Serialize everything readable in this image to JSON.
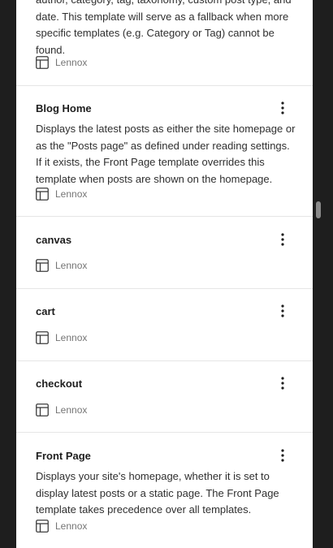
{
  "top_partial": {
    "desc_lines": [
      "author, category, tag, taxonomy, custom post type, and",
      "date. This template will serve as a fallback when more",
      "specific templates (e.g. Category or Tag) cannot be",
      "found."
    ],
    "author": "Lennox"
  },
  "templates": [
    {
      "title": "Blog Home",
      "desc_lines": [
        "Displays the latest posts as either the site homepage or",
        "as the \"Posts page\" as defined under reading settings.",
        "If it exists, the Front Page template overrides this",
        "template when posts are shown on the homepage."
      ],
      "author": "Lennox"
    },
    {
      "title": "canvas",
      "desc_lines": [],
      "author": "Lennox"
    },
    {
      "title": "cart",
      "desc_lines": [],
      "author": "Lennox"
    },
    {
      "title": "checkout",
      "desc_lines": [],
      "author": "Lennox"
    },
    {
      "title": "Front Page",
      "desc_lines": [
        "Displays your site's homepage, whether it is set to",
        "display latest posts or a static page. The Front Page",
        "template takes precedence over all templates."
      ],
      "author": "Lennox"
    }
  ],
  "icons": {
    "meta_icon": "layout-icon",
    "actions_icon": "more-vertical-icon"
  }
}
